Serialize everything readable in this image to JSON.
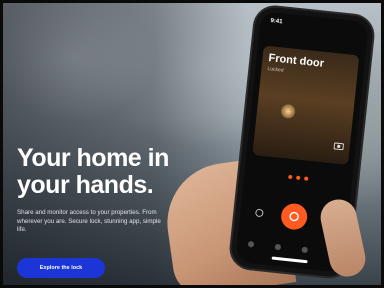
{
  "hero": {
    "headline_line1": "Your home in",
    "headline_line2": "your hands.",
    "body": "Share and monitor access to your properties. From wherever you are. Secure lock, stunning app, simple life.",
    "cta_label": "Explore the lock"
  },
  "phone": {
    "status_time": "9:41",
    "lock_name": "Front door",
    "lock_status": "Locked"
  },
  "colors": {
    "cta": "#1c35d6",
    "accent": "#ff5a1f"
  }
}
